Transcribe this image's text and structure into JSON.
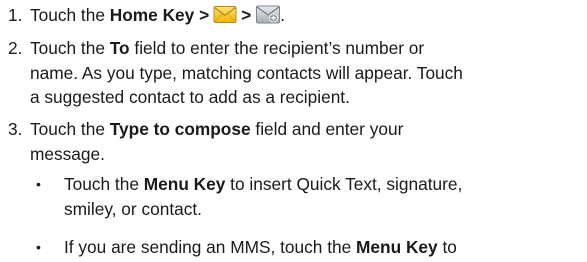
{
  "steps": [
    {
      "number": "1.",
      "lead": "Touch the ",
      "key": "Home Key >",
      "sep": ">",
      "end": "."
    },
    {
      "number": "2.",
      "line1_pre": "Touch the ",
      "line1_bold": "To",
      "line1_post": " field to enter the recipient’s number or",
      "line2": "name. As you type, matching contacts will appear. Touch",
      "line3": "a suggested contact to add as a recipient."
    },
    {
      "number": "3.",
      "line1_pre": "Touch the ",
      "line1_bold": "Type to compose",
      "line1_post": " field and enter your",
      "line2": "message."
    }
  ],
  "bullets": [
    {
      "marker": "•",
      "line1_pre": "Touch the ",
      "line1_bold": "Menu Key",
      "line1_post": " to insert Quick Text, signature,",
      "line2": "smiley, or contact."
    },
    {
      "marker": "•",
      "line1_pre": "If you are sending an MMS, touch the ",
      "line1_bold": "Menu Key",
      "line1_post": " to"
    }
  ],
  "icons": {
    "envelope": "envelope-icon",
    "compose": "compose-message-icon"
  },
  "colors": {
    "envelope_yellow": "#f6c21c",
    "envelope_border": "#b98a0c",
    "compose_gray": "#9aa1a8",
    "text": "#1a1a1a"
  }
}
